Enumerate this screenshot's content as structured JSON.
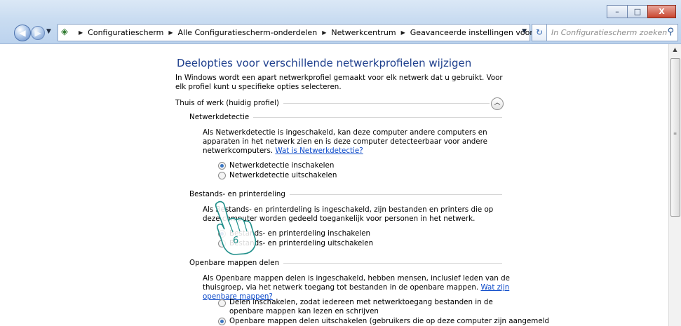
{
  "window": {
    "minimize_label": "–",
    "maximize_label": "□",
    "close_label": "X"
  },
  "nav": {
    "breadcrumbs": [
      "Configuratiescherm",
      "Alle Configuratiescherm-onderdelen",
      "Netwerkcentrum",
      "Geavanceerde instellingen voor delen"
    ],
    "search_placeholder": "In Configuratiescherm zoeken"
  },
  "main": {
    "title": "Deelopties voor verschillende netwerkprofielen wijzigen",
    "intro": "In Windows wordt een apart netwerkprofiel gemaakt voor elk netwerk dat u gebruikt. Voor elk profiel kunt u specifieke opties selecteren.",
    "profile_label": "Thuis of werk (huidig profiel)",
    "sections": {
      "netwerkdetectie": {
        "label": "Netwerkdetectie",
        "description": "Als Netwerkdetectie is ingeschakeld, kan deze computer andere computers en apparaten in het netwerk zien en is deze computer detecteerbaar voor andere netwerkcomputers.",
        "link": "Wat is Netwerkdetectie?",
        "options": [
          "Netwerkdetectie inschakelen",
          "Netwerkdetectie uitschakelen"
        ],
        "selected_index": 0
      },
      "bestanden": {
        "label": "Bestands- en printerdeling",
        "description": "Als Bestands- en printerdeling is ingeschakeld, zijn bestanden en printers die op deze computer worden gedeeld toegankelijk voor personen in het netwerk.",
        "options": [
          "Bestands- en printerdeling inschakelen",
          "Bestands- en printerdeling uitschakelen"
        ],
        "selected_index": 0
      },
      "openbare_mappen": {
        "label": "Openbare mappen delen",
        "description": "Als Openbare mappen delen is ingeschakeld, hebben mensen, inclusief leden van de thuisgroep, via het netwerk toegang tot bestanden in de openbare mappen.",
        "link": "Wat zijn openbare mappen?",
        "options": [
          "Delen inschakelen, zodat iedereen met netwerktoegang bestanden in de openbare mappen kan lezen en schrijven",
          "Openbare mappen delen uitschakelen (gebruikers die op deze computer zijn aangemeld"
        ],
        "selected_index": 1
      }
    }
  },
  "annotation": {
    "step_number": "6"
  },
  "colors": {
    "title_blue": "#1e3f8d",
    "link_blue": "#0b49c9",
    "chrome_blue": "#c9dcf1"
  }
}
